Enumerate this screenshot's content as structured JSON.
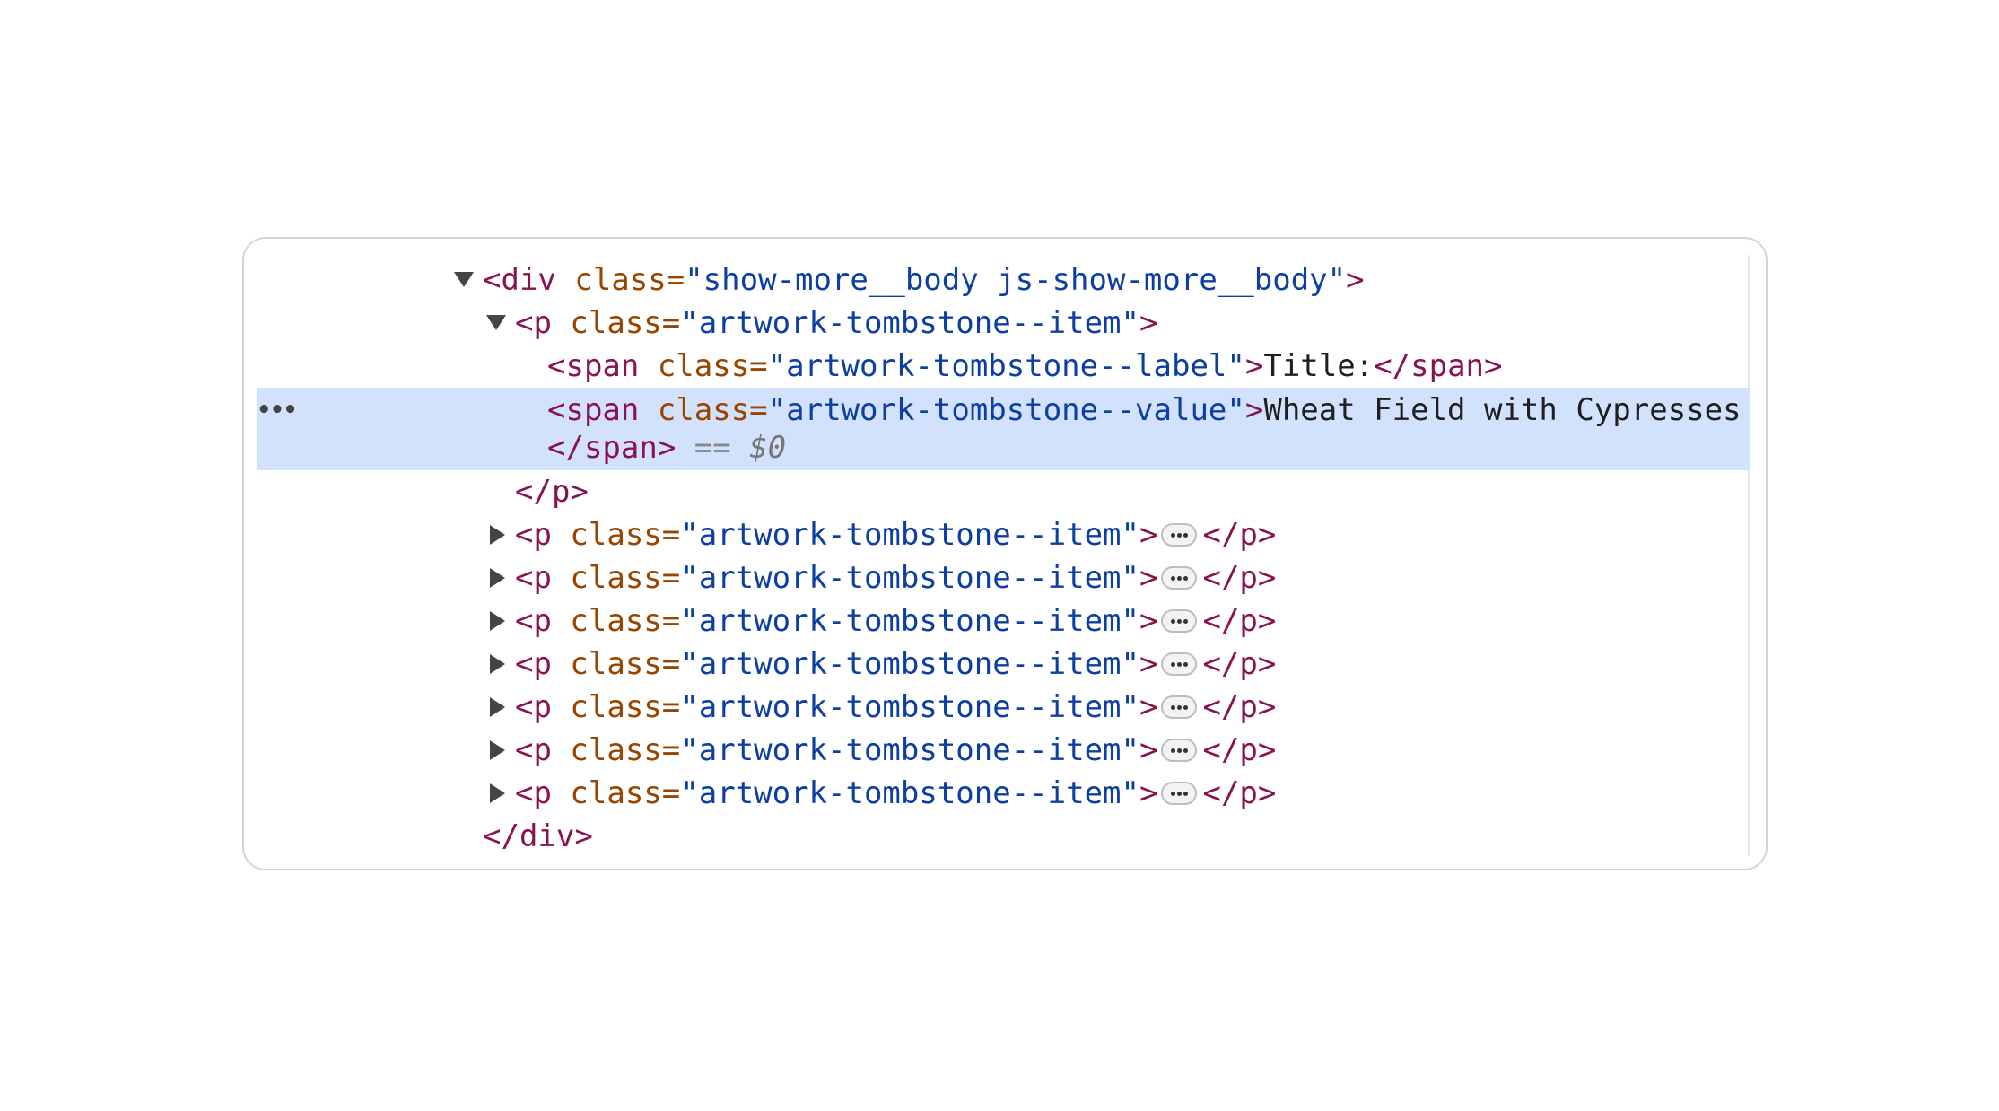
{
  "dom": {
    "div_open": {
      "tag": "<div",
      "attr": " class=",
      "value": "\"show-more__body js-show-more__body\"",
      "close": ">"
    },
    "p_open": {
      "tag": "<p",
      "attr": " class=",
      "value": "\"artwork-tombstone--item\"",
      "close": ">"
    },
    "label_span": {
      "tag": "<span",
      "attr": " class=",
      "value": "\"artwork-tombstone--label\"",
      "close": ">",
      "text": "Title:",
      "end": "</span>"
    },
    "value_span": {
      "tag": "<span",
      "attr": " class=",
      "value": "\"artwork-tombstone--value\"",
      "close": ">",
      "text": "Wheat Field with Cypresses",
      "end": "</span>",
      "eq": " == ",
      "ref": "$0"
    },
    "p_close": "</p>",
    "collapsed_items": [
      {
        "tag": "<p",
        "attr": " class=",
        "value": "\"artwork-tombstone--item\"",
        "close": ">",
        "end": "</p>"
      },
      {
        "tag": "<p",
        "attr": " class=",
        "value": "\"artwork-tombstone--item\"",
        "close": ">",
        "end": "</p>"
      },
      {
        "tag": "<p",
        "attr": " class=",
        "value": "\"artwork-tombstone--item\"",
        "close": ">",
        "end": "</p>"
      },
      {
        "tag": "<p",
        "attr": " class=",
        "value": "\"artwork-tombstone--item\"",
        "close": ">",
        "end": "</p>"
      },
      {
        "tag": "<p",
        "attr": " class=",
        "value": "\"artwork-tombstone--item\"",
        "close": ">",
        "end": "</p>"
      },
      {
        "tag": "<p",
        "attr": " class=",
        "value": "\"artwork-tombstone--item\"",
        "close": ">",
        "end": "</p>"
      },
      {
        "tag": "<p",
        "attr": " class=",
        "value": "\"artwork-tombstone--item\"",
        "close": ">",
        "end": "</p>"
      }
    ],
    "div_close": "</div>",
    "gutter_menu": "•••"
  },
  "colors": {
    "tag": "#881350",
    "attribute_name": "#994500",
    "attribute_value": "#0d3ea1",
    "selection": "#d3e2fc"
  },
  "icons": {
    "expanded": "triangle-down-icon",
    "collapsed": "triangle-right-icon",
    "ellipsis": "ellipsis-pill-icon"
  }
}
